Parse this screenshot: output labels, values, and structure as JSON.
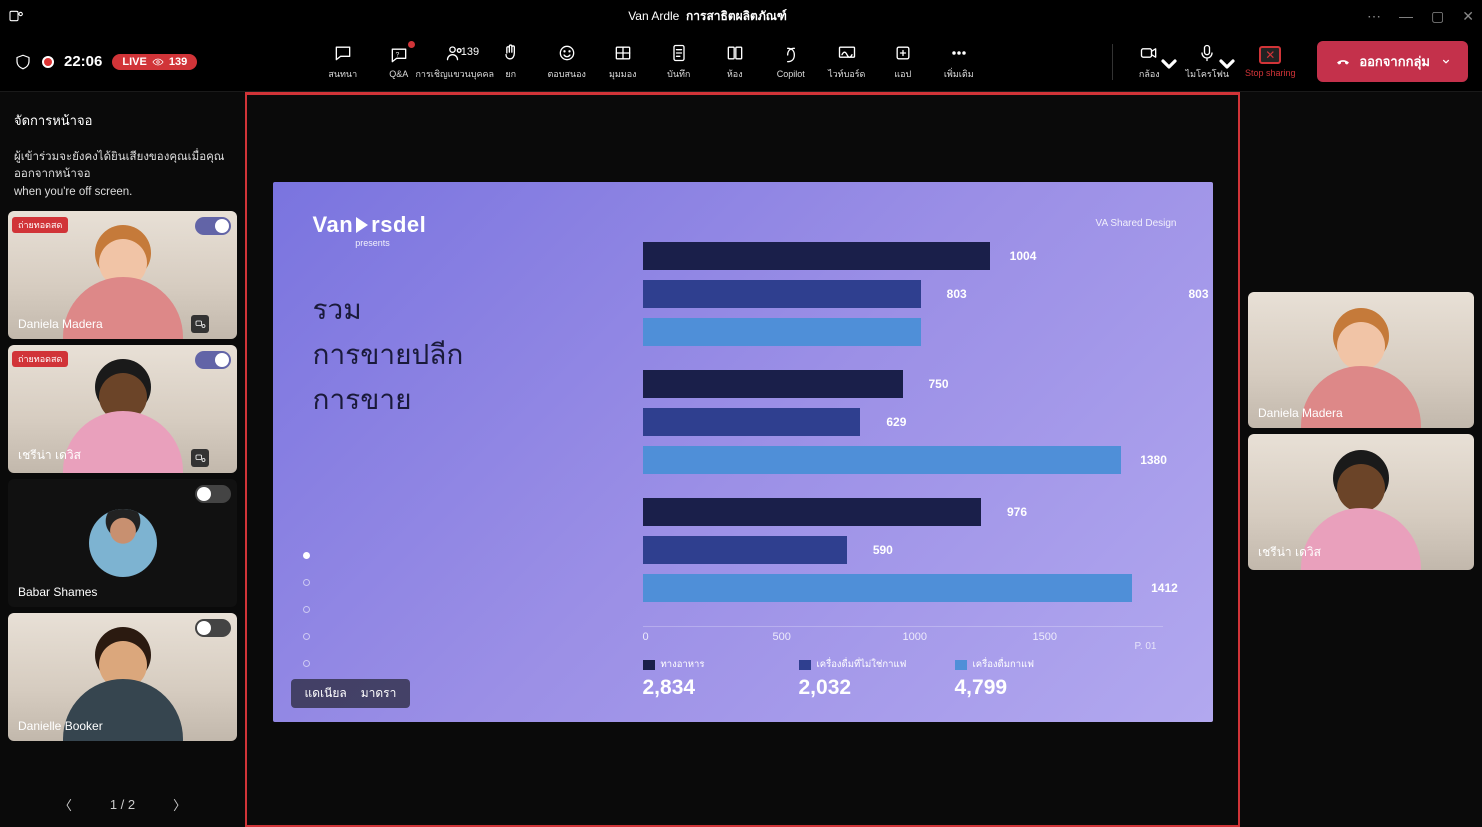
{
  "title_bar": {
    "app_name": "Van Ardle",
    "meeting_name": "การสาธิตผลิตภัณฑ์"
  },
  "status": {
    "elapsed": "22:06",
    "live_label": "LIVE",
    "viewer_count": "139"
  },
  "toolbar": {
    "chat": "สนทนา",
    "qa": "Q&A",
    "people": "การเชิญแขวนบุคคล",
    "people_count": "139",
    "raise": "ยก",
    "react": "ตอบสนอง",
    "view": "มุมมอง",
    "notes": "บันทึก",
    "rooms": "ห้อง",
    "copilot": "Copilot",
    "whiteboard": "ไวท์บอร์ด",
    "apps": "แอป",
    "more": "เพิ่มเติม",
    "camera": "กล้อง",
    "mic": "ไมโครโฟน",
    "stop_share": "Stop sharing",
    "leave": "ออกจากกลุ่ม"
  },
  "left_panel": {
    "title": "จัดการหน้าจอ",
    "subtitle_line1": "ผู้เข้าร่วมจะยังคงได้ยินเสียงของคุณเมื่อคุณออกจากหน้าจอ",
    "subtitle_line2": "when you're off screen."
  },
  "pager": {
    "current": "1",
    "total": "2",
    "display": "1 / 2"
  },
  "thumbs_left": [
    {
      "name": "Daniela Madera",
      "badge": "ถ่ายทอดสด",
      "toggle": true,
      "spotlight": true,
      "skin": "#f1c4a6",
      "hair": "#c57a3a",
      "shirt": "#d88"
    },
    {
      "name": "เชรีน่า เดวิส",
      "badge": "ถ่ายทอดสด",
      "toggle": true,
      "spotlight": true,
      "skin": "#6b4428",
      "hair": "#1a1a1a",
      "shirt": "#e9a0bc"
    },
    {
      "name": "Babar Shames",
      "badge": "",
      "toggle": false,
      "spotlight": false,
      "avatar": true,
      "skin": "#c89070",
      "hair": "#222",
      "shirt": "#7db3d1"
    },
    {
      "name": "Danielle Booker",
      "badge": "",
      "toggle": false,
      "spotlight": false,
      "skin": "#dba77c",
      "hair": "#2b1a10",
      "shirt": "#36454f"
    }
  ],
  "thumbs_right": [
    {
      "name": "Daniela Madera",
      "skin": "#f1c4a6",
      "hair": "#c57a3a",
      "shirt": "#d88"
    },
    {
      "name": "เชรีน่า เดวิส",
      "skin": "#6b4428",
      "hair": "#1a1a1a",
      "shirt": "#e9a0bc"
    }
  ],
  "slide": {
    "brand": "Van Arsdel",
    "presents": "presents",
    "tag": "VA Shared Design",
    "heading_l1": "รวม",
    "heading_l2": "การขายปลีก",
    "heading_l3": "การขาย",
    "page": "P. 01",
    "presenter_l": "แดเนียล",
    "presenter_r": "มาดรา"
  },
  "chart_data": {
    "type": "bar",
    "orientation": "horizontal",
    "xlabel": "",
    "ylabel": "",
    "xlim": [
      0,
      1500
    ],
    "ticks": [
      0,
      500,
      1000,
      1500
    ],
    "groups": [
      {
        "values": [
          1004,
          803,
          803
        ],
        "extra_label_index": 2,
        "extra_label": 803
      },
      {
        "values": [
          750,
          629,
          1380
        ]
      },
      {
        "values": [
          976,
          590,
          1412
        ]
      }
    ],
    "series_colors": [
      "#1a1f4a",
      "#2f3f8f",
      "#4f8fd8"
    ],
    "legend": [
      {
        "name": "ทางอาหาร",
        "total": "2,834"
      },
      {
        "name": "เครื่องดื่มที่ไม่ใช่กาแฟ",
        "total": "2,032"
      },
      {
        "name": "เครื่องดื่มกาแฟ",
        "total": "4,799"
      }
    ]
  }
}
